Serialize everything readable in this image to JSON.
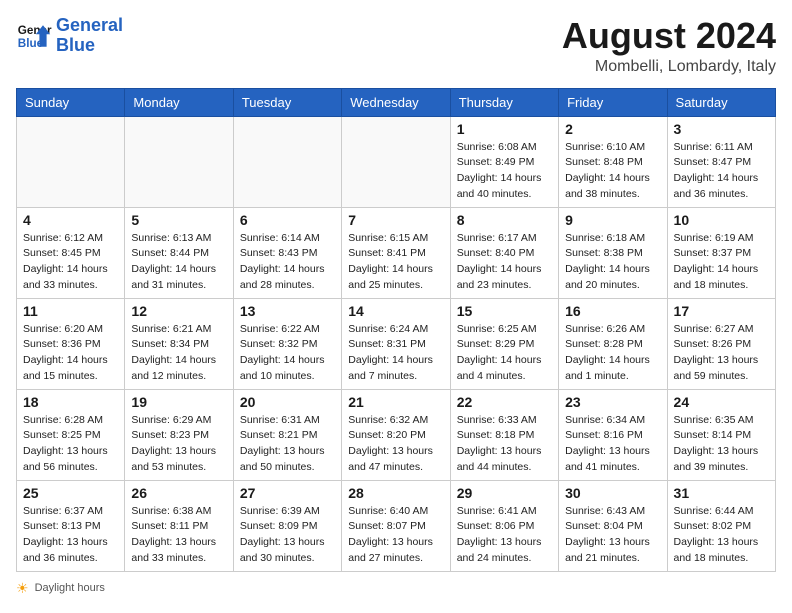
{
  "logo": {
    "line1": "General",
    "line2": "Blue"
  },
  "title": "August 2024",
  "location": "Mombelli, Lombardy, Italy",
  "days_of_week": [
    "Sunday",
    "Monday",
    "Tuesday",
    "Wednesday",
    "Thursday",
    "Friday",
    "Saturday"
  ],
  "footer_text": "Daylight hours",
  "weeks": [
    [
      {
        "day": "",
        "info": ""
      },
      {
        "day": "",
        "info": ""
      },
      {
        "day": "",
        "info": ""
      },
      {
        "day": "",
        "info": ""
      },
      {
        "day": "1",
        "info": "Sunrise: 6:08 AM\nSunset: 8:49 PM\nDaylight: 14 hours\nand 40 minutes."
      },
      {
        "day": "2",
        "info": "Sunrise: 6:10 AM\nSunset: 8:48 PM\nDaylight: 14 hours\nand 38 minutes."
      },
      {
        "day": "3",
        "info": "Sunrise: 6:11 AM\nSunset: 8:47 PM\nDaylight: 14 hours\nand 36 minutes."
      }
    ],
    [
      {
        "day": "4",
        "info": "Sunrise: 6:12 AM\nSunset: 8:45 PM\nDaylight: 14 hours\nand 33 minutes."
      },
      {
        "day": "5",
        "info": "Sunrise: 6:13 AM\nSunset: 8:44 PM\nDaylight: 14 hours\nand 31 minutes."
      },
      {
        "day": "6",
        "info": "Sunrise: 6:14 AM\nSunset: 8:43 PM\nDaylight: 14 hours\nand 28 minutes."
      },
      {
        "day": "7",
        "info": "Sunrise: 6:15 AM\nSunset: 8:41 PM\nDaylight: 14 hours\nand 25 minutes."
      },
      {
        "day": "8",
        "info": "Sunrise: 6:17 AM\nSunset: 8:40 PM\nDaylight: 14 hours\nand 23 minutes."
      },
      {
        "day": "9",
        "info": "Sunrise: 6:18 AM\nSunset: 8:38 PM\nDaylight: 14 hours\nand 20 minutes."
      },
      {
        "day": "10",
        "info": "Sunrise: 6:19 AM\nSunset: 8:37 PM\nDaylight: 14 hours\nand 18 minutes."
      }
    ],
    [
      {
        "day": "11",
        "info": "Sunrise: 6:20 AM\nSunset: 8:36 PM\nDaylight: 14 hours\nand 15 minutes."
      },
      {
        "day": "12",
        "info": "Sunrise: 6:21 AM\nSunset: 8:34 PM\nDaylight: 14 hours\nand 12 minutes."
      },
      {
        "day": "13",
        "info": "Sunrise: 6:22 AM\nSunset: 8:32 PM\nDaylight: 14 hours\nand 10 minutes."
      },
      {
        "day": "14",
        "info": "Sunrise: 6:24 AM\nSunset: 8:31 PM\nDaylight: 14 hours\nand 7 minutes."
      },
      {
        "day": "15",
        "info": "Sunrise: 6:25 AM\nSunset: 8:29 PM\nDaylight: 14 hours\nand 4 minutes."
      },
      {
        "day": "16",
        "info": "Sunrise: 6:26 AM\nSunset: 8:28 PM\nDaylight: 14 hours\nand 1 minute."
      },
      {
        "day": "17",
        "info": "Sunrise: 6:27 AM\nSunset: 8:26 PM\nDaylight: 13 hours\nand 59 minutes."
      }
    ],
    [
      {
        "day": "18",
        "info": "Sunrise: 6:28 AM\nSunset: 8:25 PM\nDaylight: 13 hours\nand 56 minutes."
      },
      {
        "day": "19",
        "info": "Sunrise: 6:29 AM\nSunset: 8:23 PM\nDaylight: 13 hours\nand 53 minutes."
      },
      {
        "day": "20",
        "info": "Sunrise: 6:31 AM\nSunset: 8:21 PM\nDaylight: 13 hours\nand 50 minutes."
      },
      {
        "day": "21",
        "info": "Sunrise: 6:32 AM\nSunset: 8:20 PM\nDaylight: 13 hours\nand 47 minutes."
      },
      {
        "day": "22",
        "info": "Sunrise: 6:33 AM\nSunset: 8:18 PM\nDaylight: 13 hours\nand 44 minutes."
      },
      {
        "day": "23",
        "info": "Sunrise: 6:34 AM\nSunset: 8:16 PM\nDaylight: 13 hours\nand 41 minutes."
      },
      {
        "day": "24",
        "info": "Sunrise: 6:35 AM\nSunset: 8:14 PM\nDaylight: 13 hours\nand 39 minutes."
      }
    ],
    [
      {
        "day": "25",
        "info": "Sunrise: 6:37 AM\nSunset: 8:13 PM\nDaylight: 13 hours\nand 36 minutes."
      },
      {
        "day": "26",
        "info": "Sunrise: 6:38 AM\nSunset: 8:11 PM\nDaylight: 13 hours\nand 33 minutes."
      },
      {
        "day": "27",
        "info": "Sunrise: 6:39 AM\nSunset: 8:09 PM\nDaylight: 13 hours\nand 30 minutes."
      },
      {
        "day": "28",
        "info": "Sunrise: 6:40 AM\nSunset: 8:07 PM\nDaylight: 13 hours\nand 27 minutes."
      },
      {
        "day": "29",
        "info": "Sunrise: 6:41 AM\nSunset: 8:06 PM\nDaylight: 13 hours\nand 24 minutes."
      },
      {
        "day": "30",
        "info": "Sunrise: 6:43 AM\nSunset: 8:04 PM\nDaylight: 13 hours\nand 21 minutes."
      },
      {
        "day": "31",
        "info": "Sunrise: 6:44 AM\nSunset: 8:02 PM\nDaylight: 13 hours\nand 18 minutes."
      }
    ]
  ]
}
